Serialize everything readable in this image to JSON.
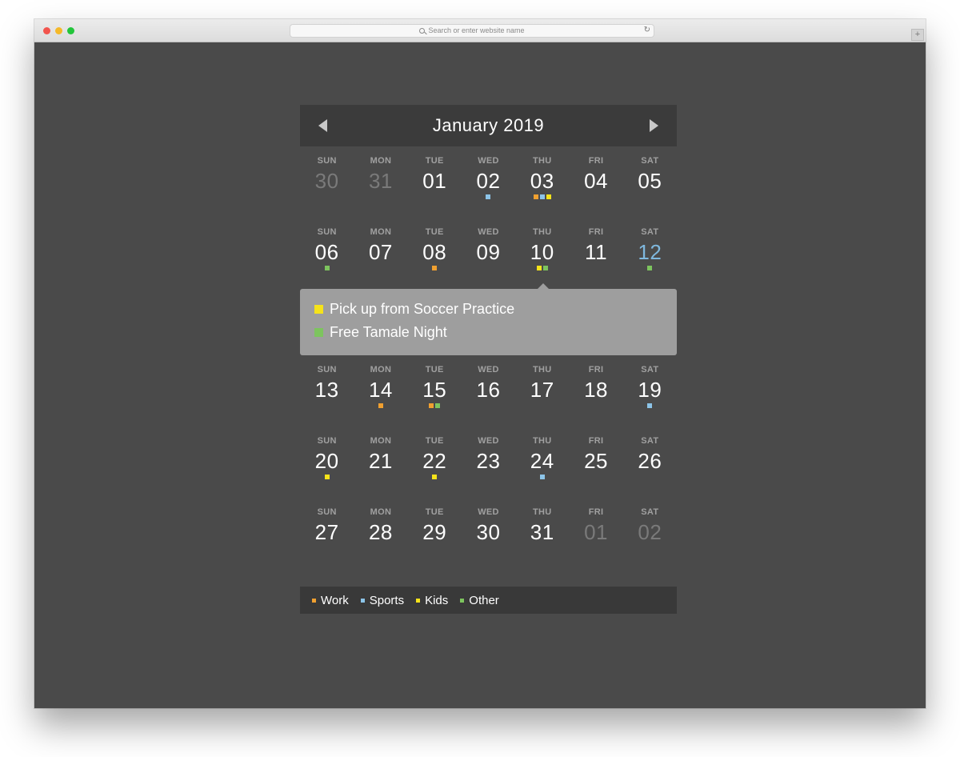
{
  "browser": {
    "address_placeholder": "Search or enter website name",
    "reload_glyph": "↻",
    "newtab_glyph": "+"
  },
  "colors": {
    "work": "#f0a030",
    "sports": "#8cc4e8",
    "kids": "#f5e31a",
    "other": "#7dc45e"
  },
  "calendar": {
    "title": "January 2019",
    "prev_label": "previous month",
    "next_label": "next month",
    "weeks": [
      {
        "days": [
          {
            "dow": "SUN",
            "num": "30",
            "state": "muted",
            "events": []
          },
          {
            "dow": "MON",
            "num": "31",
            "state": "muted",
            "events": []
          },
          {
            "dow": "TUE",
            "num": "01",
            "state": "",
            "events": []
          },
          {
            "dow": "WED",
            "num": "02",
            "state": "",
            "events": [
              "sports"
            ]
          },
          {
            "dow": "THU",
            "num": "03",
            "state": "",
            "events": [
              "work",
              "sports",
              "kids"
            ]
          },
          {
            "dow": "FRI",
            "num": "04",
            "state": "",
            "events": []
          },
          {
            "dow": "SAT",
            "num": "05",
            "state": "",
            "events": []
          }
        ]
      },
      {
        "days": [
          {
            "dow": "SUN",
            "num": "06",
            "state": "",
            "events": [
              "other"
            ]
          },
          {
            "dow": "MON",
            "num": "07",
            "state": "",
            "events": []
          },
          {
            "dow": "TUE",
            "num": "08",
            "state": "",
            "events": [
              "work"
            ]
          },
          {
            "dow": "WED",
            "num": "09",
            "state": "",
            "events": []
          },
          {
            "dow": "THU",
            "num": "10",
            "state": "selected",
            "events": [
              "kids",
              "other"
            ]
          },
          {
            "dow": "FRI",
            "num": "11",
            "state": "",
            "events": []
          },
          {
            "dow": "SAT",
            "num": "12",
            "state": "highlight",
            "events": [
              "other"
            ]
          }
        ]
      },
      {
        "days": [
          {
            "dow": "SUN",
            "num": "13",
            "state": "",
            "events": []
          },
          {
            "dow": "MON",
            "num": "14",
            "state": "",
            "events": [
              "work"
            ]
          },
          {
            "dow": "TUE",
            "num": "15",
            "state": "",
            "events": [
              "work",
              "other"
            ]
          },
          {
            "dow": "WED",
            "num": "16",
            "state": "",
            "events": []
          },
          {
            "dow": "THU",
            "num": "17",
            "state": "",
            "events": []
          },
          {
            "dow": "FRI",
            "num": "18",
            "state": "",
            "events": []
          },
          {
            "dow": "SAT",
            "num": "19",
            "state": "",
            "events": [
              "sports"
            ]
          }
        ]
      },
      {
        "days": [
          {
            "dow": "SUN",
            "num": "20",
            "state": "",
            "events": [
              "kids"
            ]
          },
          {
            "dow": "MON",
            "num": "21",
            "state": "",
            "events": []
          },
          {
            "dow": "TUE",
            "num": "22",
            "state": "",
            "events": [
              "kids"
            ]
          },
          {
            "dow": "WED",
            "num": "23",
            "state": "",
            "events": []
          },
          {
            "dow": "THU",
            "num": "24",
            "state": "",
            "events": [
              "sports"
            ]
          },
          {
            "dow": "FRI",
            "num": "25",
            "state": "",
            "events": []
          },
          {
            "dow": "SAT",
            "num": "26",
            "state": "",
            "events": []
          }
        ]
      },
      {
        "days": [
          {
            "dow": "SUN",
            "num": "27",
            "state": "",
            "events": []
          },
          {
            "dow": "MON",
            "num": "28",
            "state": "",
            "events": []
          },
          {
            "dow": "TUE",
            "num": "29",
            "state": "",
            "events": []
          },
          {
            "dow": "WED",
            "num": "30",
            "state": "",
            "events": []
          },
          {
            "dow": "THU",
            "num": "31",
            "state": "",
            "events": []
          },
          {
            "dow": "FRI",
            "num": "01",
            "state": "muted",
            "events": []
          },
          {
            "dow": "SAT",
            "num": "02",
            "state": "muted",
            "events": []
          }
        ]
      }
    ],
    "popover_after_week": 1,
    "popover": {
      "events": [
        {
          "category": "kids",
          "title": "Pick up from Soccer Practice"
        },
        {
          "category": "other",
          "title": "Free Tamale Night"
        }
      ]
    }
  },
  "legend": {
    "items": [
      {
        "category": "work",
        "label": "Work"
      },
      {
        "category": "sports",
        "label": "Sports"
      },
      {
        "category": "kids",
        "label": "Kids"
      },
      {
        "category": "other",
        "label": "Other"
      }
    ]
  }
}
